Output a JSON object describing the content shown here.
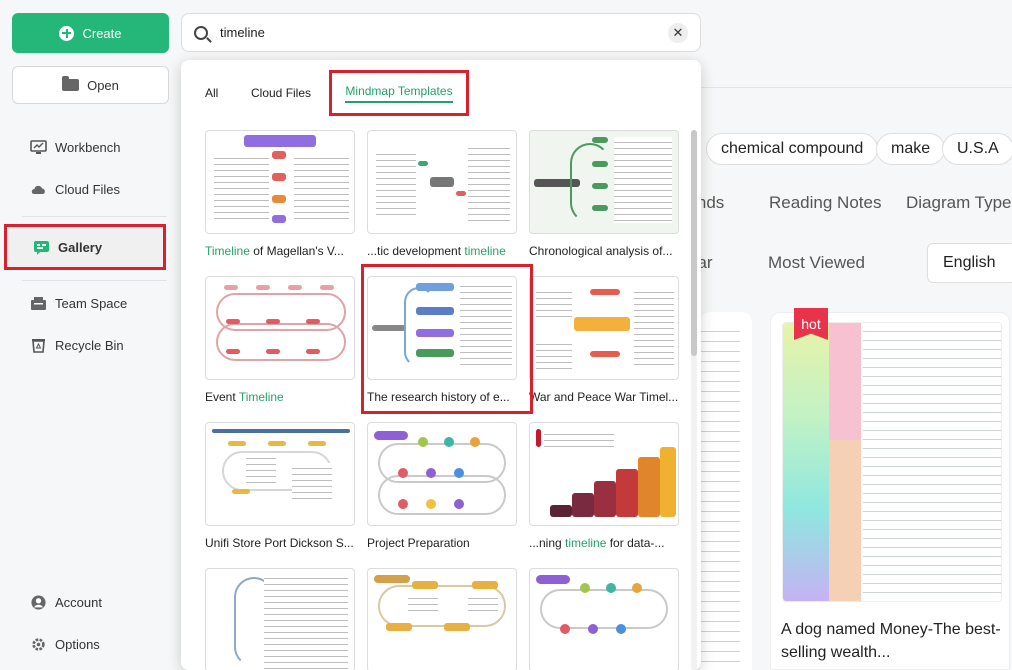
{
  "sidebar": {
    "create_label": "Create",
    "open_label": "Open",
    "items": [
      {
        "label": "Workbench",
        "icon": "workbench-icon"
      },
      {
        "label": "Cloud Files",
        "icon": "cloud-icon"
      },
      {
        "label": "Gallery",
        "icon": "gallery-icon"
      },
      {
        "label": "Team Space",
        "icon": "team-space-icon"
      },
      {
        "label": "Recycle Bin",
        "icon": "recycle-bin-icon"
      },
      {
        "label": "Account",
        "icon": "account-icon"
      },
      {
        "label": "Options",
        "icon": "gear-icon"
      }
    ]
  },
  "search": {
    "value": "timeline",
    "clear_glyph": "✕"
  },
  "dropdown": {
    "tabs": [
      {
        "label": "All"
      },
      {
        "label": "Cloud Files"
      },
      {
        "label": "Mindmap Templates"
      }
    ],
    "results": [
      {
        "before": "",
        "hl": "Timeline",
        "after": " of Magellan's V..."
      },
      {
        "before": "...tic development ",
        "hl": "timeline",
        "after": ""
      },
      {
        "before": "Chronological analysis of...",
        "hl": "",
        "after": ""
      },
      {
        "before": "Event ",
        "hl": "Timeline",
        "after": ""
      },
      {
        "before": "The research history of e...",
        "hl": "",
        "after": ""
      },
      {
        "before": "War and Peace War Timel...",
        "hl": "",
        "after": ""
      },
      {
        "before": "Unifi Store Port Dickson S...",
        "hl": "",
        "after": ""
      },
      {
        "before": "Project Preparation",
        "hl": "",
        "after": ""
      },
      {
        "before": "...ning ",
        "hl": "timeline",
        "after": " for data-..."
      }
    ]
  },
  "background": {
    "tags": [
      "chemical compound",
      "make",
      "U.S.A"
    ],
    "categories": [
      "Trends",
      "Reading Notes",
      "Diagram Type"
    ],
    "sort": [
      "Popular",
      "Most Viewed"
    ],
    "language": "English",
    "hot_badge": "hot",
    "card_title": "A dog named Money-The best-selling wealth..."
  },
  "colors": {
    "accent": "#25b67a",
    "highlight": "#25a06d",
    "annotation_red": "#d8212c",
    "hot": "#e8334a"
  }
}
